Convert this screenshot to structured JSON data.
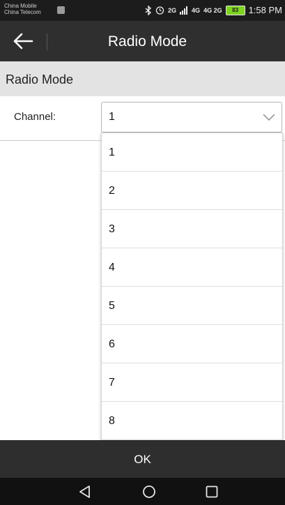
{
  "status_bar": {
    "carrier_1": "China Mobile",
    "carrier_2": "China Telecom",
    "signal_2g": "2G",
    "signal_4g": "4G",
    "signal_4g_2g": "4G 2G",
    "battery": "83",
    "time": "1:58 PM",
    "icons": [
      "sim-icon",
      "bluetooth-icon",
      "alarm-icon",
      "signal-icon",
      "battery-icon"
    ]
  },
  "app_bar": {
    "title": "Radio Mode",
    "back_icon": "back-arrow-icon"
  },
  "section": {
    "title": "Radio Mode"
  },
  "form": {
    "channel_label": "Channel:",
    "channel_value": "1",
    "channel_options": [
      "1",
      "2",
      "3",
      "4",
      "5",
      "6",
      "7",
      "8"
    ]
  },
  "ok_label": "OK",
  "nav": {
    "icons": [
      "back-triangle-icon",
      "home-circle-icon",
      "recents-square-icon"
    ]
  }
}
